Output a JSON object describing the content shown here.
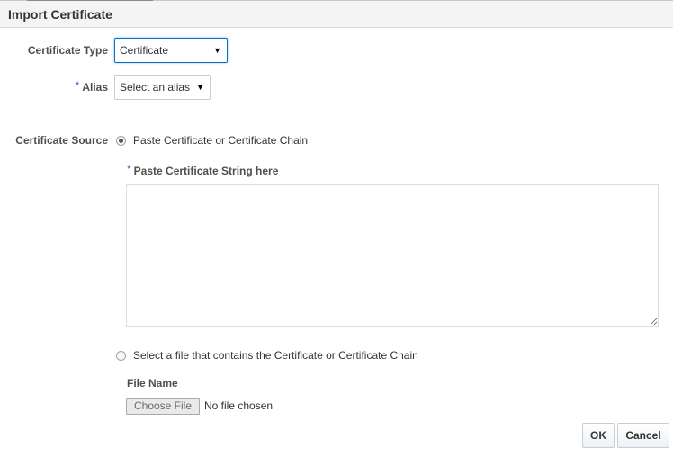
{
  "dialog": {
    "title": "Import Certificate"
  },
  "form": {
    "certificate_type": {
      "label": "Certificate Type",
      "value": "Certificate"
    },
    "alias": {
      "required_mark": "*",
      "label": "Alias",
      "value": "Select an alias"
    },
    "certificate_source": {
      "label": "Certificate Source",
      "options": [
        {
          "label": "Paste Certificate or Certificate Chain",
          "selected": true
        },
        {
          "label": "Select a file that contains the Certificate or Certificate Chain",
          "selected": false
        }
      ]
    },
    "paste_field": {
      "required_mark": "*",
      "label": "Paste Certificate String here",
      "value": ""
    },
    "file": {
      "label": "File Name",
      "button_label": "Choose File",
      "status": "No file chosen"
    }
  },
  "buttons": {
    "ok": "OK",
    "cancel": "Cancel"
  },
  "icons": {
    "dropdown": "caret-down-icon",
    "radio_selected": "radio-selected-icon",
    "radio_unselected": "radio-unselected-icon"
  },
  "colors": {
    "accent": "#0572ce",
    "required": "#2c6bb7",
    "header_bg": "#f4f4f4"
  }
}
